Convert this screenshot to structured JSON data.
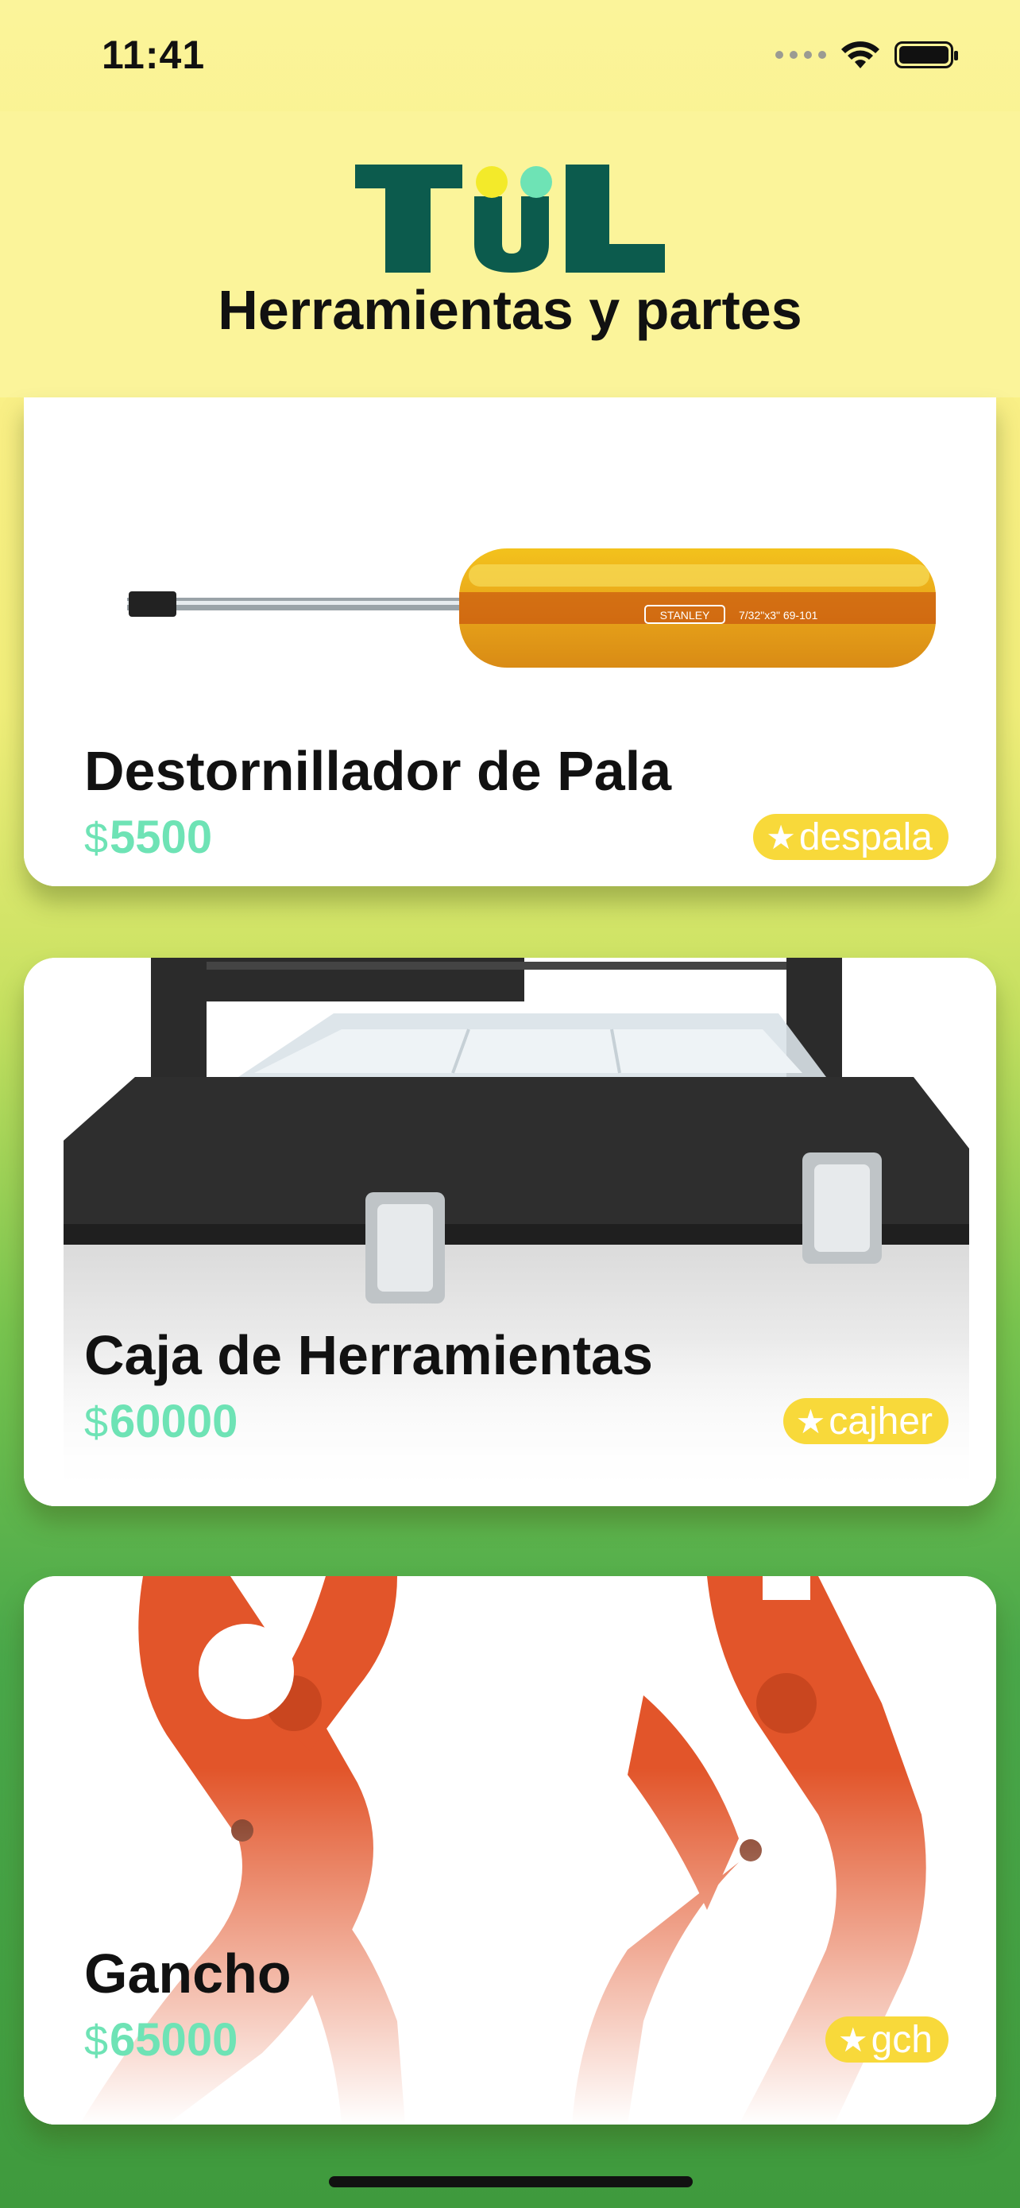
{
  "status": {
    "time": "11:41"
  },
  "header": {
    "logo_text": "TUL",
    "subtitle": "Herramientas y partes",
    "brand_color": "#0c5b4d",
    "dot_yellow": "#f3ea2a",
    "dot_mint": "#6ee3b5"
  },
  "products": [
    {
      "name": "Destornillador de Pala",
      "currency": "$",
      "price": "5500",
      "code": "despala"
    },
    {
      "name": "Caja de Herramientas",
      "currency": "$",
      "price": "60000",
      "code": "cajher"
    },
    {
      "name": "Gancho",
      "currency": "$",
      "price": "65000",
      "code": "gch"
    }
  ],
  "screwdriver_label": {
    "brand": "STANLEY",
    "spec": "7/32\"x3\" 69-101"
  },
  "icons": {
    "star": "★",
    "wifi": "wifi-icon",
    "battery": "battery-icon"
  }
}
